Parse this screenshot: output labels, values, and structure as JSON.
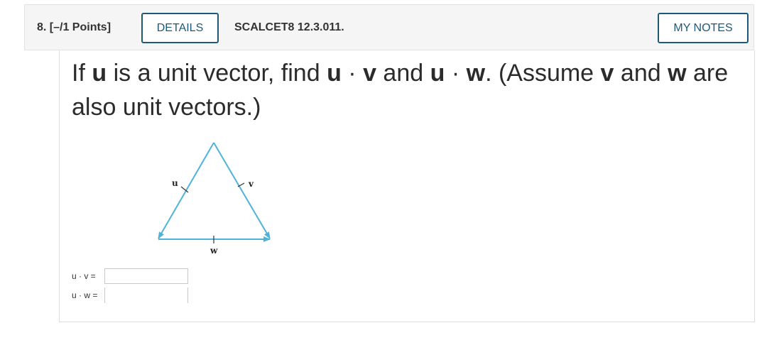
{
  "header": {
    "question_label": "8.  [–/1 Points]",
    "details_label": "DETAILS",
    "reference": "SCALCET8 12.3.011.",
    "notes_label": "MY NOTES"
  },
  "question": {
    "parts": [
      "If ",
      "u",
      " is a unit vector, find ",
      "u",
      " · ",
      "v",
      " and ",
      "u",
      " · ",
      "w",
      ". (Assume ",
      "v",
      " and ",
      "w",
      " are also unit vectors.)"
    ]
  },
  "figure": {
    "labels": {
      "u": "u",
      "v": "v",
      "w": "w"
    },
    "line_color": "#4fb3d9"
  },
  "answers": [
    {
      "label": "u · v =",
      "value": "",
      "placeholder": ""
    },
    {
      "label": "u · w =",
      "value": "",
      "placeholder": ""
    }
  ],
  "colors": {
    "accent": "#1e5a78",
    "header_bg": "#f5f5f5",
    "border": "#dddddd"
  }
}
